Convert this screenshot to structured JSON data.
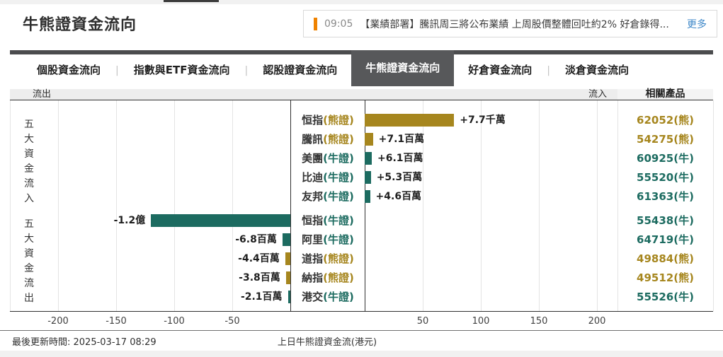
{
  "page": {
    "title": "牛熊證資金流向",
    "news": {
      "time": "09:05",
      "headline": "【業績部署】騰訊周三將公布業績 上周股價整體回吐約2% 好倉錄得...",
      "more_label": "更多",
      "accent_color": "#ef8200"
    },
    "tabs": [
      {
        "label": "個股資金流向",
        "active": false
      },
      {
        "label": "指數與ETF資金流向",
        "active": false
      },
      {
        "label": "認股證資金流向",
        "active": false
      },
      {
        "label": "牛熊證資金流向",
        "active": true
      },
      {
        "label": "好倉資金流向",
        "active": false
      },
      {
        "label": "淡倉資金流向",
        "active": false
      }
    ],
    "footer": {
      "updated": "最後更新時間: 2025-03-17 08:29",
      "axis_caption": "上日牛熊證資金流(港元)"
    }
  },
  "chart_data": {
    "type": "bar",
    "orientation": "horizontal",
    "unit": "百萬 (millions HKD)",
    "outflow_header": "流出",
    "inflow_header": "流入",
    "product_header": "相關產品",
    "group_label_inflow": "五大資金流入",
    "group_label_outflow": "五大資金流出",
    "axis_ticks": [
      -200,
      -150,
      -100,
      -50,
      50,
      100,
      150,
      200
    ],
    "xlim": [
      -240,
      300
    ],
    "colors": {
      "bull": "#1c6b60",
      "bear": "#a6861e"
    },
    "rows": [
      {
        "name": "恒指",
        "type_label": "(熊證)",
        "side": "bear",
        "value_mn": 77,
        "value_label": "+7.7千萬",
        "product": "62052(熊)"
      },
      {
        "name": "騰訊",
        "type_label": "(熊證)",
        "side": "bear",
        "value_mn": 7.1,
        "value_label": "+7.1百萬",
        "product": "54275(熊)"
      },
      {
        "name": "美團",
        "type_label": "(牛證)",
        "side": "bull",
        "value_mn": 6.1,
        "value_label": "+6.1百萬",
        "product": "60925(牛)"
      },
      {
        "name": "比迪",
        "type_label": "(牛證)",
        "side": "bull",
        "value_mn": 5.3,
        "value_label": "+5.3百萬",
        "product": "55520(牛)"
      },
      {
        "name": "友邦",
        "type_label": "(牛證)",
        "side": "bull",
        "value_mn": 4.6,
        "value_label": "+4.6百萬",
        "product": "61363(牛)"
      },
      {
        "name": "恒指",
        "type_label": "(牛證)",
        "side": "bull",
        "value_mn": -120,
        "value_label": "-1.2億",
        "product": "55438(牛)"
      },
      {
        "name": "阿里",
        "type_label": "(牛證)",
        "side": "bull",
        "value_mn": -6.8,
        "value_label": "-6.8百萬",
        "product": "64719(牛)"
      },
      {
        "name": "道指",
        "type_label": "(熊證)",
        "side": "bear",
        "value_mn": -4.4,
        "value_label": "-4.4百萬",
        "product": "49884(熊)"
      },
      {
        "name": "納指",
        "type_label": "(熊證)",
        "side": "bear",
        "value_mn": -3.8,
        "value_label": "-3.8百萬",
        "product": "49512(熊)"
      },
      {
        "name": "港交",
        "type_label": "(牛證)",
        "side": "bull",
        "value_mn": -2.1,
        "value_label": "-2.1百萬",
        "product": "55526(牛)"
      }
    ]
  }
}
